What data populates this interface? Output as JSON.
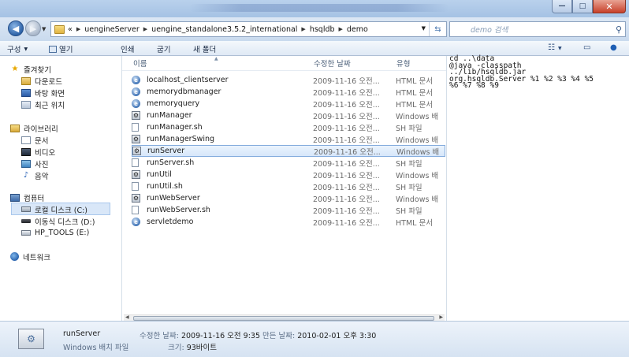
{
  "window": {
    "minimize_glyph": "—",
    "maximize_glyph": "□",
    "close_glyph": "✕"
  },
  "address": {
    "overflow": "«",
    "crumbs": [
      "uengineServer",
      "uengine_standalone3.5.2_international",
      "hsqldb",
      "demo"
    ],
    "search_placeholder": "demo 검색"
  },
  "toolbar": {
    "organize": "구성",
    "open": "열기",
    "print": "인쇄",
    "burn": "굽기",
    "new_folder": "새 폴더"
  },
  "nav": {
    "favorites": "즐겨찾기",
    "downloads": "다운로드",
    "desktop": "바탕 화면",
    "recent": "최근 위치",
    "libraries": "라이브러리",
    "documents": "문서",
    "videos": "비디오",
    "pictures": "사진",
    "music": "음악",
    "computer": "컴퓨터",
    "local_disk": "로컬 디스크 (C:)",
    "removable": "이동식 디스크 (D:)",
    "hp_tools": "HP_TOOLS (E:)",
    "network": "네트워크"
  },
  "columns": {
    "name": "이름",
    "date": "수정한 날짜",
    "type": "유형"
  },
  "files": [
    {
      "name": "localhost_clientserver",
      "date": "2009-11-16 오전...",
      "type": "HTML 문서",
      "kind": "html"
    },
    {
      "name": "memorydbmanager",
      "date": "2009-11-16 오전...",
      "type": "HTML 문서",
      "kind": "html"
    },
    {
      "name": "memoryquery",
      "date": "2009-11-16 오전...",
      "type": "HTML 문서",
      "kind": "html"
    },
    {
      "name": "runManager",
      "date": "2009-11-16 오전...",
      "type": "Windows 배",
      "kind": "bat"
    },
    {
      "name": "runManager.sh",
      "date": "2009-11-16 오전...",
      "type": "SH 파일",
      "kind": "sh"
    },
    {
      "name": "runManagerSwing",
      "date": "2009-11-16 오전...",
      "type": "Windows 배",
      "kind": "bat"
    },
    {
      "name": "runServer",
      "date": "2009-11-16 오전...",
      "type": "Windows 배",
      "kind": "bat"
    },
    {
      "name": "runServer.sh",
      "date": "2009-11-16 오전...",
      "type": "SH 파일",
      "kind": "sh"
    },
    {
      "name": "runUtil",
      "date": "2009-11-16 오전...",
      "type": "Windows 배",
      "kind": "bat"
    },
    {
      "name": "runUtil.sh",
      "date": "2009-11-16 오전...",
      "type": "SH 파일",
      "kind": "sh"
    },
    {
      "name": "runWebServer",
      "date": "2009-11-16 오전...",
      "type": "Windows 배",
      "kind": "bat"
    },
    {
      "name": "runWebServer.sh",
      "date": "2009-11-16 오전...",
      "type": "SH 파일",
      "kind": "sh"
    },
    {
      "name": "servletdemo",
      "date": "2009-11-16 오전...",
      "type": "HTML 문서",
      "kind": "html"
    }
  ],
  "selected_file": "runServer",
  "preview_text": "cd ..\\data\n@java -classpath\n../lib/hsqldb.jar\norg.hsqldb.Server %1 %2 %3 %4 %5\n%6 %7 %8 %9",
  "details": {
    "name": "runServer",
    "type": "Windows 배치 파일",
    "modified_label": "수정한 날짜:",
    "modified_value": "2009-11-16 오전 9:35",
    "created_label": "만든 날짜:",
    "created_value": "2010-02-01 오후 3:30",
    "size_label": "크기:",
    "size_value": "93바이트"
  },
  "icons": {
    "back": "back-arrow-icon",
    "forward": "forward-arrow-icon",
    "search": "magnifier-icon",
    "views": "views-icon",
    "preview": "preview-pane-icon",
    "help": "help-icon"
  },
  "colors": {
    "titlebar": "#b9d1ec",
    "selection": "#d7e7fa",
    "close_button": "#c8412a"
  }
}
